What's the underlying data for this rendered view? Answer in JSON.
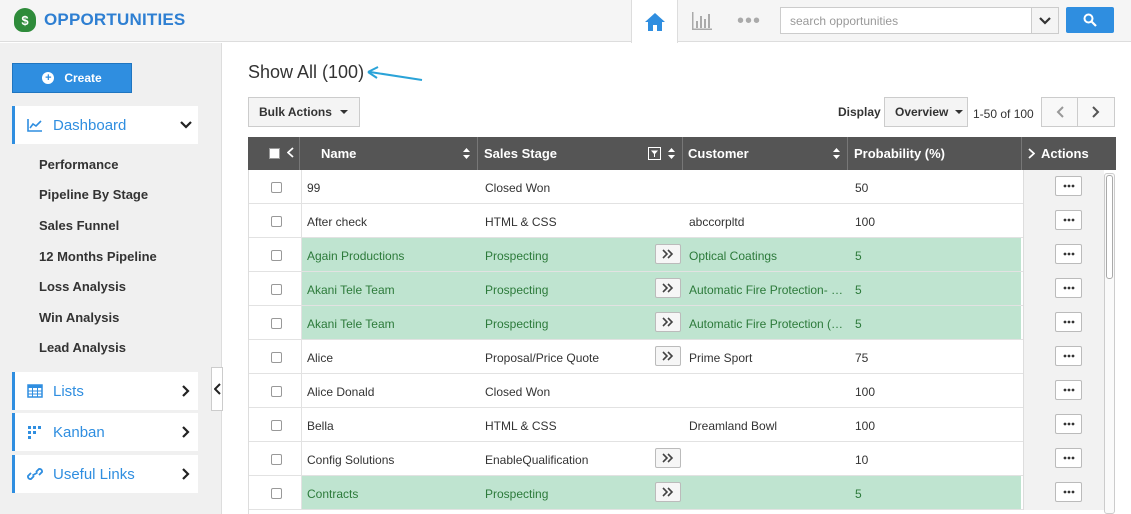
{
  "app": {
    "title": "OPPORTUNITIES",
    "logo_symbol": "$"
  },
  "topnav": {
    "more_icon": "•••"
  },
  "search": {
    "placeholder": "search opportunities"
  },
  "sidebar": {
    "create_label": "Create",
    "dashboard": {
      "label": "Dashboard",
      "items": [
        "Performance",
        "Pipeline By Stage",
        "Sales Funnel",
        "12 Months Pipeline",
        "Loss Analysis",
        "Win Analysis",
        "Lead Analysis"
      ]
    },
    "lists": {
      "label": "Lists"
    },
    "kanban": {
      "label": "Kanban"
    },
    "useful_links": {
      "label": "Useful Links"
    }
  },
  "main": {
    "title": "Show All (100)",
    "bulk_actions_label": "Bulk Actions",
    "display_label": "Display",
    "display_value": "Overview",
    "page_range": "1-50 of 100"
  },
  "table": {
    "columns": {
      "name": "Name",
      "stage": "Sales Stage",
      "customer": "Customer",
      "probability": "Probability (%)",
      "actions": "Actions"
    },
    "highlight_color": "#bfe4d0",
    "rows": [
      {
        "name": "99",
        "stage": "Closed Won",
        "customer": "",
        "probability": "50",
        "highlight": false,
        "stage_arrow": false
      },
      {
        "name": "After check",
        "stage": "HTML & CSS",
        "customer": "abccorpltd",
        "probability": "100",
        "highlight": false,
        "stage_arrow": false
      },
      {
        "name": "Again Productions",
        "stage": "Prospecting",
        "customer": "Optical Coatings",
        "probability": "5",
        "highlight": true,
        "stage_arrow": true
      },
      {
        "name": "Akani Tele Team",
        "stage": "Prospecting",
        "customer": "Automatic Fire Protection- …",
        "probability": "5",
        "highlight": true,
        "stage_arrow": true
      },
      {
        "name": "Akani Tele Team",
        "stage": "Prospecting",
        "customer": "Automatic Fire Protection (…",
        "probability": "5",
        "highlight": true,
        "stage_arrow": true
      },
      {
        "name": "Alice",
        "stage": "Proposal/Price Quote",
        "customer": "Prime Sport",
        "probability": "75",
        "highlight": false,
        "stage_arrow": true
      },
      {
        "name": "Alice Donald",
        "stage": "Closed Won",
        "customer": "",
        "probability": "100",
        "highlight": false,
        "stage_arrow": false
      },
      {
        "name": "Bella",
        "stage": "HTML & CSS",
        "customer": "Dreamland Bowl",
        "probability": "100",
        "highlight": false,
        "stage_arrow": false
      },
      {
        "name": "Config Solutions",
        "stage": "EnableQualification",
        "customer": "",
        "probability": "10",
        "highlight": false,
        "stage_arrow": true
      },
      {
        "name": "Contracts",
        "stage": "Prospecting",
        "customer": "",
        "probability": "5",
        "highlight": true,
        "stage_arrow": true
      }
    ]
  },
  "colors": {
    "brand_blue": "#2f8ee0",
    "brand_green": "#2e8b3a",
    "header_gray": "#555555",
    "annotation_arrow": "#2aa3d8"
  }
}
